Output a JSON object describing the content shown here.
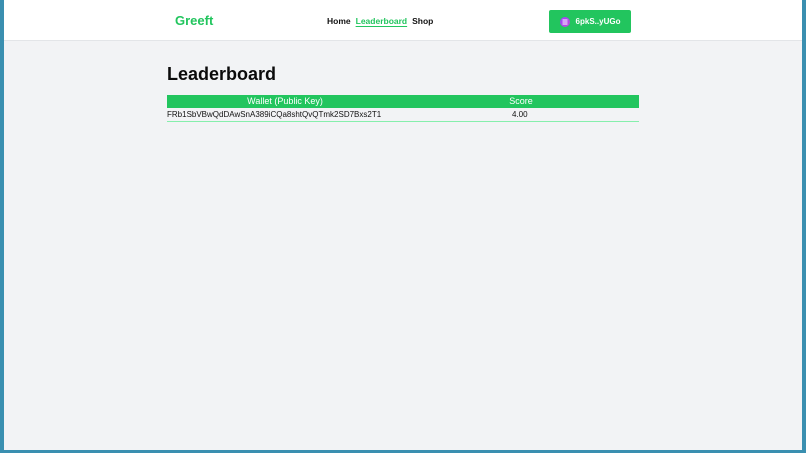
{
  "navbar": {
    "brand": "Greeft",
    "links": [
      {
        "label": "Home",
        "active": false
      },
      {
        "label": "Leaderboard",
        "active": true
      },
      {
        "label": "Shop",
        "active": false
      }
    ],
    "wallet_button": {
      "label": "6pkS..yUGo",
      "icon": "solana-wallet-icon"
    }
  },
  "main": {
    "title": "Leaderboard",
    "table": {
      "headers": [
        "Wallet (Public Key)",
        "Score"
      ],
      "rows": [
        {
          "wallet": "FRb1SbVBwQdDAwSnA389iCQa8shtQvQTmk2SD7Bxs2T1",
          "score": "4.00"
        }
      ]
    }
  },
  "colors": {
    "accent": "#22c55e",
    "row_divider": "#86efac",
    "background": "#f2f3f5"
  }
}
